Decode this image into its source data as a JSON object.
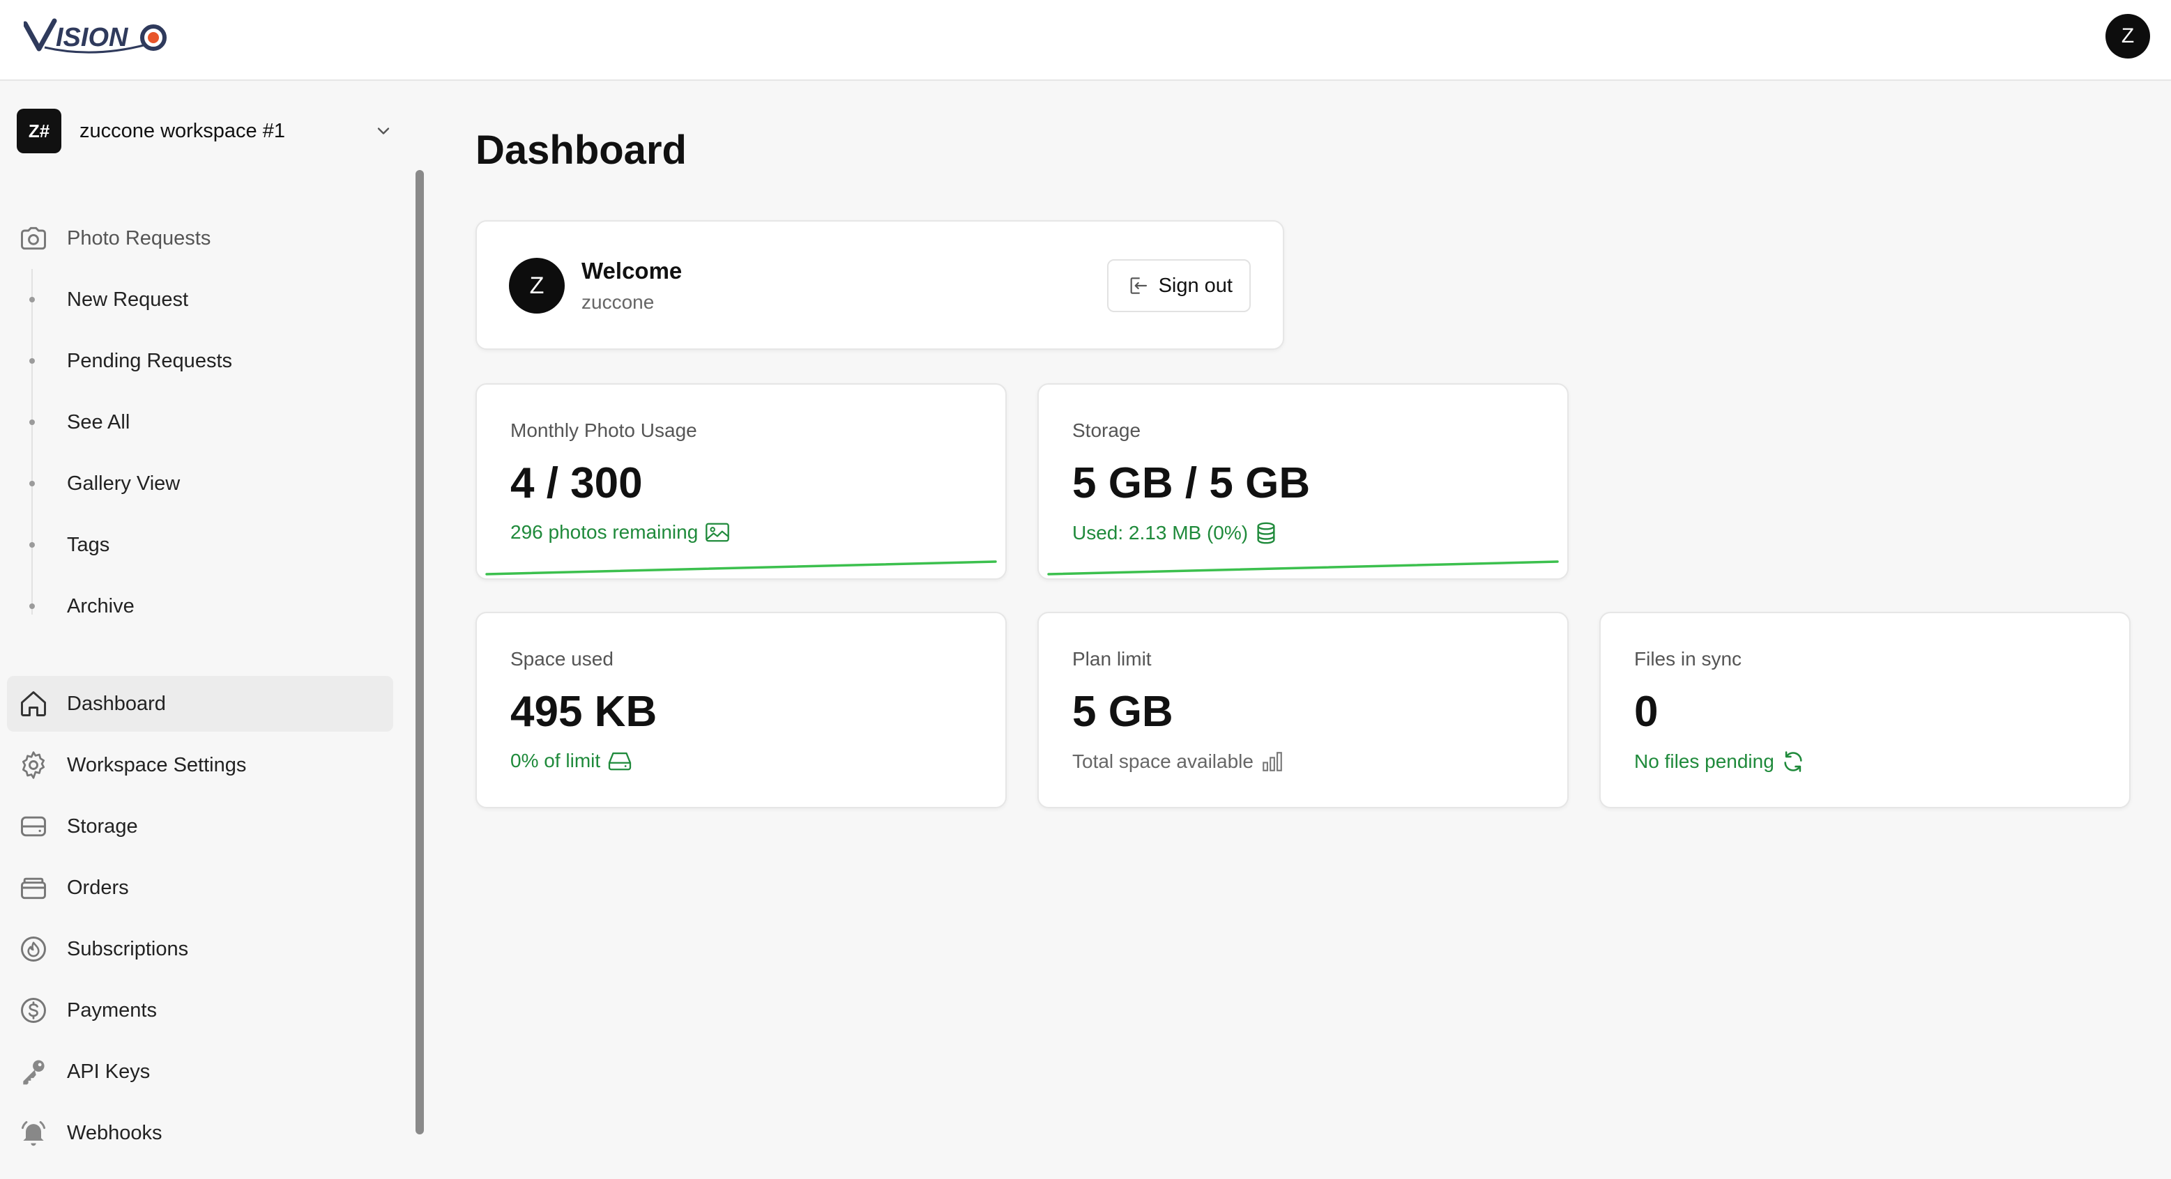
{
  "app": {
    "logo_text": "VISION",
    "user_initial": "Z"
  },
  "workspace": {
    "badge": "Z#",
    "name": "zuccone workspace #1"
  },
  "sidebar": {
    "photo_requests": {
      "label": "Photo Requests",
      "icon": "camera-icon",
      "children": [
        {
          "label": "New Request"
        },
        {
          "label": "Pending Requests"
        },
        {
          "label": "See All"
        },
        {
          "label": "Gallery View"
        },
        {
          "label": "Tags"
        },
        {
          "label": "Archive"
        }
      ]
    },
    "items": [
      {
        "label": "Dashboard",
        "icon": "home-icon",
        "active": true
      },
      {
        "label": "Workspace Settings",
        "icon": "gear-icon"
      },
      {
        "label": "Storage",
        "icon": "hard-drive-icon"
      },
      {
        "label": "Orders",
        "icon": "archive-icon"
      },
      {
        "label": "Subscriptions",
        "icon": "flame-icon"
      },
      {
        "label": "Payments",
        "icon": "dollar-circle-icon"
      },
      {
        "label": "API Keys",
        "icon": "key-icon"
      },
      {
        "label": "Webhooks",
        "icon": "bell-icon"
      }
    ]
  },
  "main": {
    "title": "Dashboard",
    "welcome": {
      "avatar": "Z",
      "title": "Welcome",
      "username": "zuccone",
      "sign_out_label": "Sign out"
    },
    "stats": [
      {
        "label": "Monthly Photo Usage",
        "value": "4 / 300",
        "note": "296 photos remaining",
        "note_icon": "image-icon",
        "progress": 0.013
      },
      {
        "label": "Storage",
        "value": "5 GB / 5 GB",
        "note": "Used: 2.13 MB (0%)",
        "note_icon": "database-icon",
        "progress": 0.0004
      },
      {
        "label": "Space used",
        "value": "495 KB",
        "note": "0% of limit",
        "note_icon": "hard-drive-icon"
      },
      {
        "label": "Plan limit",
        "value": "5 GB",
        "note": "Total space available",
        "note_icon": "bar-chart-icon"
      },
      {
        "label": "Files in sync",
        "value": "0",
        "note": "No files pending",
        "note_icon": "refresh-icon"
      }
    ]
  },
  "colors": {
    "accent_green": "#1f8a3b",
    "progress_green": "#3cc04e",
    "active_bg": "#ececec"
  }
}
